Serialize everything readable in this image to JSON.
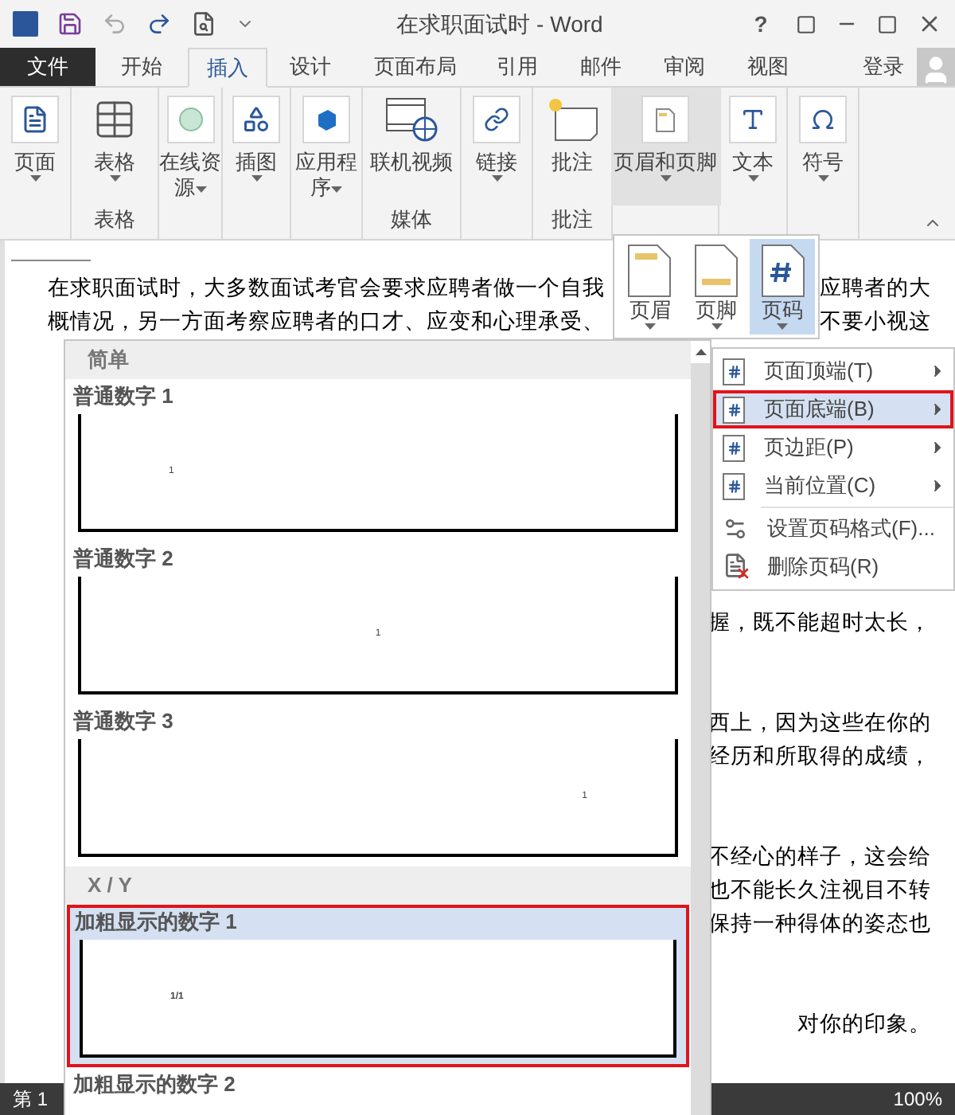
{
  "title_bar": {
    "title": "在求职面试时 - Word",
    "help": "?"
  },
  "tabs": [
    {
      "label": "文件",
      "kind": "file",
      "selected": false
    },
    {
      "label": "开始",
      "kind": "tab",
      "selected": false
    },
    {
      "label": "插入",
      "kind": "tab",
      "selected": true
    },
    {
      "label": "设计",
      "kind": "tab",
      "selected": false
    },
    {
      "label": "页面布局",
      "kind": "tab",
      "selected": false
    },
    {
      "label": "引用",
      "kind": "tab",
      "selected": false
    },
    {
      "label": "邮件",
      "kind": "tab",
      "selected": false
    },
    {
      "label": "审阅",
      "kind": "tab",
      "selected": false
    },
    {
      "label": "视图",
      "kind": "tab",
      "selected": false
    }
  ],
  "account": {
    "sign_in": "登录"
  },
  "ribbon": {
    "groups": [
      {
        "buttons": [
          {
            "label": "页面",
            "has_menu": true,
            "highlighted": false
          }
        ]
      },
      {
        "label": "表格",
        "buttons": [
          {
            "label": "表格",
            "has_menu": true,
            "highlighted": false
          }
        ]
      },
      {
        "buttons": [
          {
            "label": "在线资源",
            "has_menu": true,
            "highlighted": false
          }
        ]
      },
      {
        "buttons": [
          {
            "label": "插图",
            "has_menu": true,
            "highlighted": false
          }
        ]
      },
      {
        "buttons": [
          {
            "label": "应用程序",
            "has_menu": true,
            "highlighted": false
          }
        ]
      },
      {
        "label": "媒体",
        "buttons": [
          {
            "label": "联机视频",
            "has_menu": false,
            "highlighted": false
          }
        ]
      },
      {
        "buttons": [
          {
            "label": "链接",
            "has_menu": true,
            "highlighted": false
          }
        ]
      },
      {
        "label": "批注",
        "buttons": [
          {
            "label": "批注",
            "has_menu": false,
            "highlighted": false
          }
        ]
      },
      {
        "buttons": [
          {
            "label": "页眉和页脚",
            "has_menu": true,
            "highlighted": true
          }
        ]
      },
      {
        "buttons": [
          {
            "label": "文本",
            "has_menu": true,
            "highlighted": false
          }
        ]
      },
      {
        "buttons": [
          {
            "label": "符号",
            "has_menu": true,
            "highlighted": false
          }
        ]
      }
    ]
  },
  "document": {
    "lines": [
      {
        "kind": "text",
        "left": "在求职面试时，大多数面试考官会要求应聘者做一个自我",
        "right": "应聘者的大"
      },
      {
        "kind": "text",
        "left": "概情况，另一方面考察应聘者的口才、应变和心理承受、",
        "right": "不要小视这"
      },
      {
        "kind": "blank"
      },
      {
        "kind": "blank"
      },
      {
        "kind": "blank"
      },
      {
        "kind": "blank"
      },
      {
        "kind": "blank"
      },
      {
        "kind": "blank"
      },
      {
        "kind": "blank"
      },
      {
        "kind": "blank"
      },
      {
        "kind": "text",
        "right": "握，既不能超时太长，"
      },
      {
        "kind": "blank"
      },
      {
        "kind": "blank"
      },
      {
        "kind": "text",
        "right": "西上，因为这些在你的"
      },
      {
        "kind": "text",
        "right": "经历和所取得的成绩，"
      },
      {
        "kind": "blank"
      },
      {
        "kind": "blank"
      },
      {
        "kind": "text",
        "right": "不经心的样子，这会给"
      },
      {
        "kind": "text",
        "right": "也不能长久注视目不转"
      },
      {
        "kind": "text",
        "right": "保持一种得体的姿态也"
      },
      {
        "kind": "blank"
      },
      {
        "kind": "blank"
      },
      {
        "kind": "text",
        "right": "对你的印象。"
      }
    ]
  },
  "status_bar": {
    "page": "第 1",
    "zoom": "100%"
  },
  "header_footer_menu": {
    "items": [
      {
        "label": "页眉",
        "selected": false
      },
      {
        "label": "页脚",
        "selected": false
      },
      {
        "label": "页码",
        "selected": true
      }
    ]
  },
  "page_number_menu": {
    "items": [
      {
        "kind": "submenu",
        "label": "页面顶端(T)",
        "selected": false
      },
      {
        "kind": "submenu",
        "label": "页面底端(B)",
        "selected": true
      },
      {
        "kind": "submenu",
        "label": "页边距(P)",
        "selected": false
      },
      {
        "kind": "submenu",
        "label": "当前位置(C)",
        "selected": false
      },
      {
        "kind": "separator"
      },
      {
        "kind": "command",
        "label": "设置页码格式(F)...",
        "selected": false
      },
      {
        "kind": "command",
        "label": "删除页码(R)",
        "selected": false
      }
    ]
  },
  "gallery": {
    "entries": [
      {
        "kind": "section",
        "label": "简单"
      },
      {
        "kind": "item",
        "label": "普通数字 1",
        "number": "1",
        "selected": false
      },
      {
        "kind": "item",
        "label": "普通数字 2",
        "number": "1",
        "selected": false
      },
      {
        "kind": "item",
        "label": "普通数字 3",
        "number": "1",
        "selected": false
      },
      {
        "kind": "section",
        "label": "X / Y"
      },
      {
        "kind": "item",
        "label": "加粗显示的数字 1",
        "number": "1/1",
        "selected": true
      },
      {
        "kind": "item",
        "label": "加粗显示的数字 2",
        "selected": false
      }
    ]
  }
}
